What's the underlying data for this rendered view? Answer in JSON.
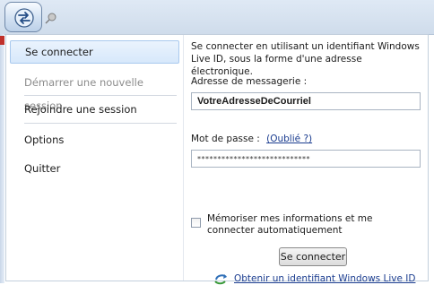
{
  "menu": {
    "items": [
      {
        "label": "Se connecter",
        "state": "selected"
      },
      {
        "label": "Démarrer une nouvelle session",
        "state": "disabled"
      },
      {
        "label": "Rejoindre une session",
        "state": "normal"
      },
      {
        "label": "Options",
        "state": "normal"
      },
      {
        "label": "Quitter",
        "state": "normal"
      }
    ]
  },
  "signin": {
    "description": "Se connecter en utilisant un identifiant Windows Live ID, sous la forme d'une adresse électronique.",
    "email_label": "Adresse de messagerie :",
    "email_value": "VotreAdresseDeCourriel",
    "password_label": "Mot de passe :",
    "forgot_link": "(Oublié ?)",
    "password_value": "****************************",
    "remember_label": "Mémoriser mes informations et me connecter automatiquement",
    "remember_checked": false,
    "submit_label": "Se connecter",
    "get_id_link": "Obtenir un identifiant Windows Live ID"
  },
  "icons": {
    "app_button": "arrows-swap-icon",
    "pin": "pin-icon",
    "live_id": "windows-live-arrow-icon"
  },
  "colors": {
    "selected_bg": "#d7e8fb",
    "link": "#1a3c8f",
    "ribbon": "#dfe9f5"
  }
}
